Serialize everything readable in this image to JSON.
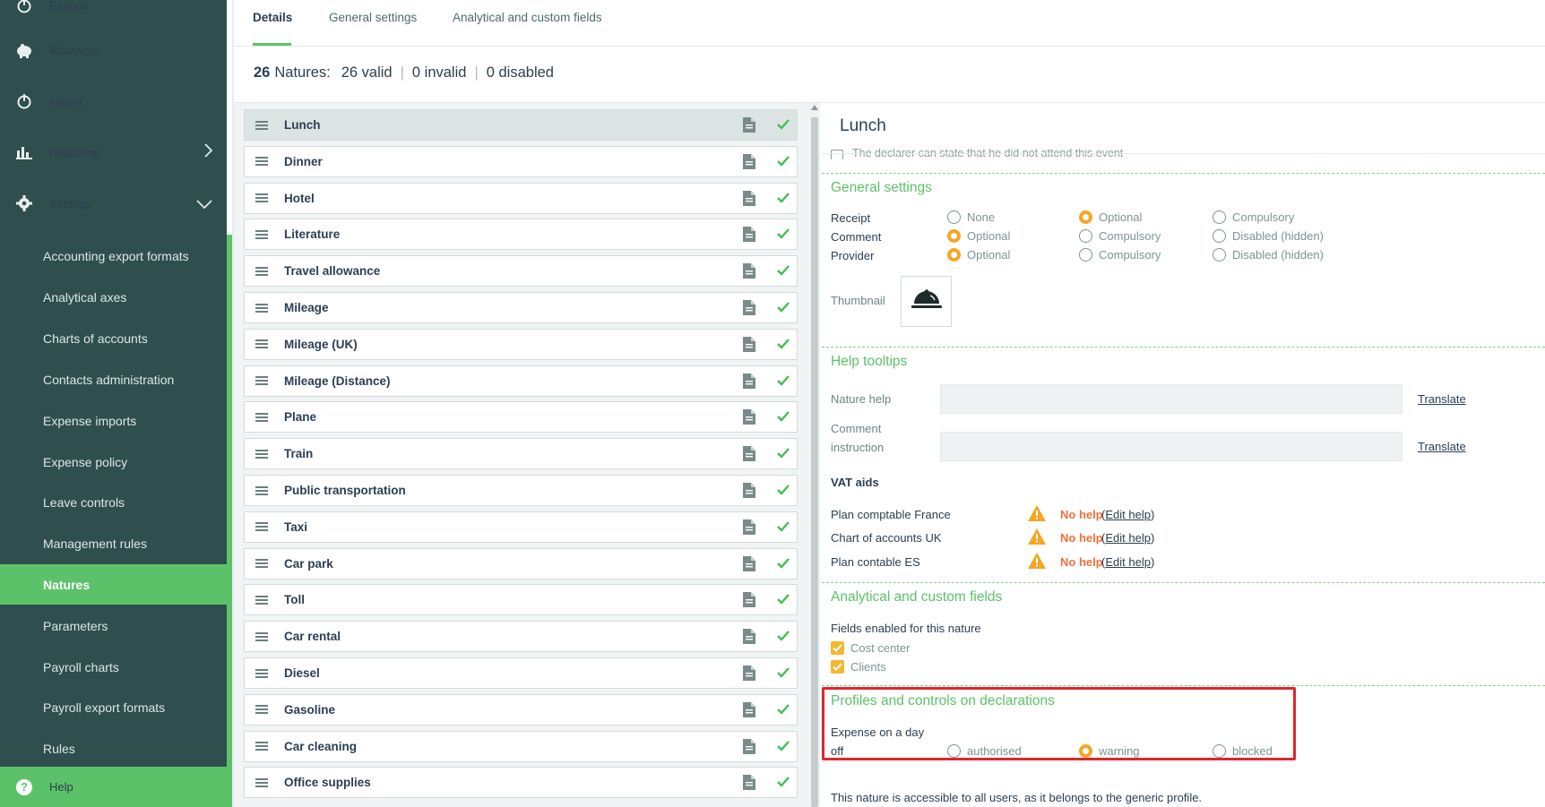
{
  "sidebar": {
    "items": [
      {
        "label": "Exports",
        "icon": "power-icon"
      },
      {
        "label": "Advances",
        "icon": "piggy-bank-icon"
      },
      {
        "label": "Import",
        "icon": "power-icon"
      },
      {
        "label": "Reporting",
        "icon": "bar-chart-icon"
      },
      {
        "label": "Settings",
        "icon": "gear-icon"
      }
    ],
    "sub_items": [
      "Accounting export formats",
      "Analytical axes",
      "Charts of accounts",
      "Contacts administration",
      "Expense imports",
      "Expense policy",
      "Leave controls",
      "Management rules",
      "Natures",
      "Parameters",
      "Payroll charts",
      "Payroll export formats",
      "Rules"
    ],
    "active_sub_item": "Natures",
    "help_label": "Help"
  },
  "tabs": [
    "Details",
    "General settings",
    "Analytical and custom fields"
  ],
  "active_tab": "Details",
  "summary": {
    "total": "26",
    "natures_label": "Natures:",
    "valid": "26 valid",
    "invalid": "0 invalid",
    "disabled": "0 disabled"
  },
  "natures": [
    "Lunch",
    "Dinner",
    "Hotel",
    "Literature",
    "Travel allowance",
    "Mileage",
    "Mileage (UK)",
    "Mileage (Distance)",
    "Plane",
    "Train",
    "Public transportation",
    "Taxi",
    "Car park",
    "Toll",
    "Car rental",
    "Diesel",
    "Gasoline",
    "Car cleaning",
    "Office supplies"
  ],
  "selected_nature": "Lunch",
  "detail": {
    "title": "Lunch",
    "cut_off_text": "The declarer can state that he did not attend this event",
    "general_settings": {
      "title": "General settings",
      "rows": [
        {
          "label": "Receipt",
          "options": [
            "None",
            "Optional",
            "Compulsory"
          ],
          "selected": "Optional"
        },
        {
          "label": "Comment",
          "options": [
            "Optional",
            "Compulsory",
            "Disabled (hidden)"
          ],
          "selected": "Optional"
        },
        {
          "label": "Provider",
          "options": [
            "Optional",
            "Compulsory",
            "Disabled (hidden)"
          ],
          "selected": "Optional"
        }
      ],
      "thumbnail_label": "Thumbnail",
      "thumbnail_icon": "food-cloche-icon"
    },
    "help_tooltips": {
      "title": "Help tooltips",
      "nature_help_label": "Nature help",
      "nature_help_value": "",
      "comment_instruction_label_1": "Comment",
      "comment_instruction_label_2": "instruction",
      "comment_instruction_value": "",
      "translate_label": "Translate"
    },
    "vat_aids": {
      "title": "VAT aids",
      "rows": [
        {
          "label": "Plan comptable France",
          "status": "No help",
          "link": "Edit help"
        },
        {
          "label": "Chart of accounts UK",
          "status": "No help",
          "link": "Edit help"
        },
        {
          "label": "Plan contable ES",
          "status": "No help",
          "link": "Edit help"
        }
      ]
    },
    "analytical": {
      "title": "Analytical and custom fields",
      "subtitle": "Fields enabled for this nature",
      "fields": [
        {
          "label": "Cost center",
          "checked": true
        },
        {
          "label": "Clients",
          "checked": true
        }
      ]
    },
    "profiles": {
      "title": "Profiles and controls on declarations",
      "row_label_1": "Expense on a day",
      "row_label_2": "off",
      "options": [
        "authorised",
        "warning",
        "blocked"
      ],
      "selected": "warning"
    },
    "footnote": "This nature is accessible to all users, as it belongs to the generic profile."
  },
  "colors": {
    "sidebar_bg": "#2f4f4f",
    "accent_green": "#5cc26a",
    "radio_selected": "#f5a623",
    "warning_orange": "#f0703a",
    "highlight_red": "#e0262c"
  }
}
